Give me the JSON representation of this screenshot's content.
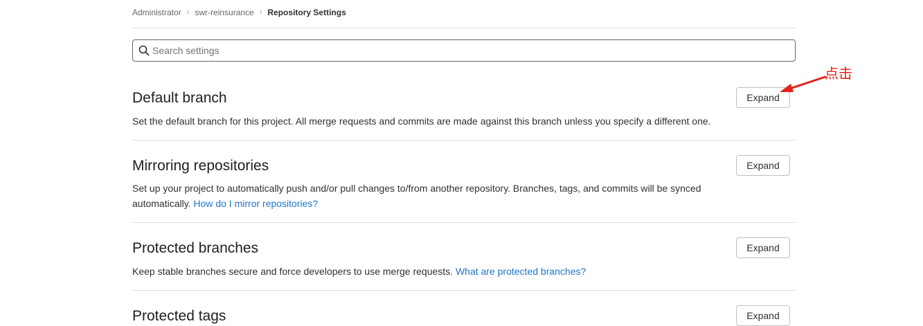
{
  "breadcrumb": {
    "items": [
      "Administrator",
      "swr-reinsurance"
    ],
    "current": "Repository Settings",
    "separator": "›"
  },
  "search": {
    "placeholder": "Search settings",
    "value": ""
  },
  "sections": [
    {
      "title": "Default branch",
      "description": "Set the default branch for this project. All merge requests and commits are made against this branch unless you specify a different one.",
      "button": "Expand"
    },
    {
      "title": "Mirroring repositories",
      "description": "Set up your project to automatically push and/or pull changes to/from another repository. Branches, tags, and commits will be synced automatically.",
      "link": "How do I mirror repositories?",
      "button": "Expand"
    },
    {
      "title": "Protected branches",
      "description": "Keep stable branches secure and force developers to use merge requests.",
      "link": "What are protected branches?",
      "button": "Expand"
    },
    {
      "title": "Protected tags",
      "button": "Expand"
    }
  ],
  "annotation": {
    "text": "点击",
    "color": "#e3221b"
  },
  "colors": {
    "link": "#1f75cb",
    "border": "#dcdcdc"
  },
  "icons": {
    "search": "search-icon",
    "chevron": "chevron-right-icon"
  }
}
